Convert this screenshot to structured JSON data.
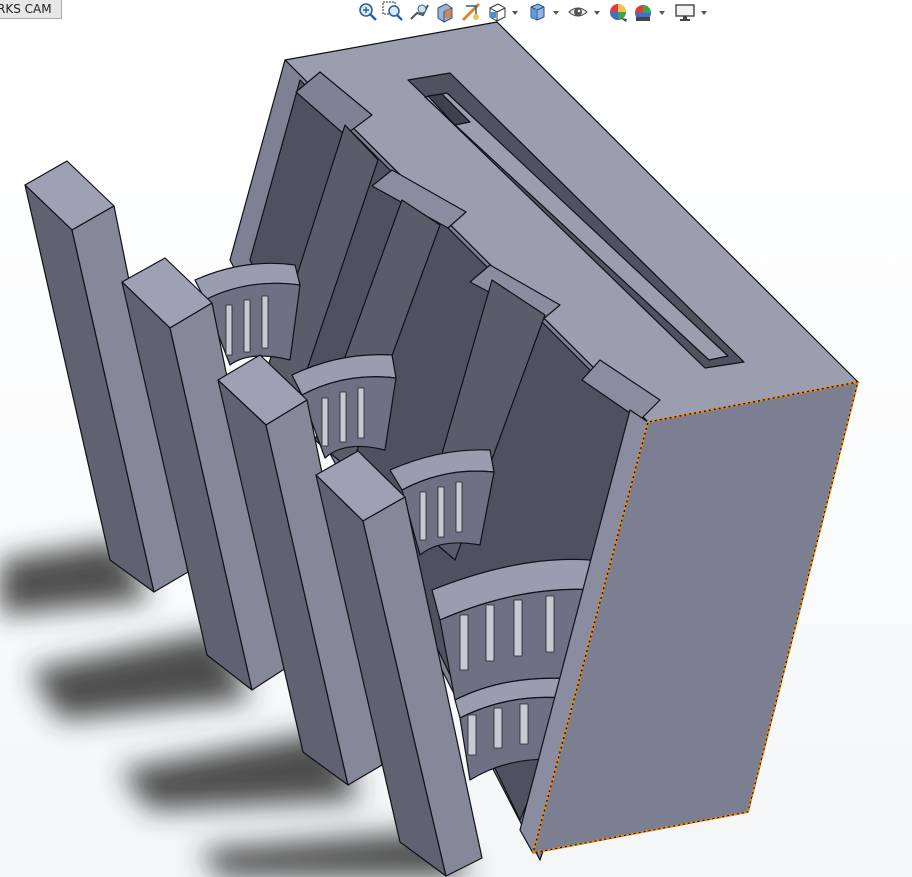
{
  "app": {
    "tab_label": "RKS CAM"
  },
  "toolbar": {
    "items": [
      {
        "icon": "zoom-to-fit-icon",
        "has_dropdown": false
      },
      {
        "icon": "zoom-to-area-icon",
        "has_dropdown": false
      },
      {
        "icon": "previous-view-icon",
        "has_dropdown": false
      },
      {
        "icon": "section-view-icon",
        "has_dropdown": false
      },
      {
        "icon": "dynamic-annotation-views-icon",
        "has_dropdown": false
      },
      {
        "icon": "view-orientation-icon",
        "has_dropdown": true
      },
      {
        "icon": "display-style-icon",
        "has_dropdown": true
      },
      {
        "icon": "hide-show-items-icon",
        "has_dropdown": true
      },
      {
        "icon": "edit-appearance-icon",
        "has_dropdown": false
      },
      {
        "icon": "apply-scene-icon",
        "has_dropdown": true
      },
      {
        "icon": "view-settings-icon",
        "has_dropdown": true
      }
    ]
  },
  "colors": {
    "background_top": "#ffffff",
    "background_bottom": "#f3f5f7",
    "part_top": "#9a9dae",
    "part_side": "#7d7f91",
    "part_dark": "#4c4e5b",
    "edge": "#111118",
    "selection_edge": "#f08a00",
    "shadow": "#3a3a3a"
  }
}
